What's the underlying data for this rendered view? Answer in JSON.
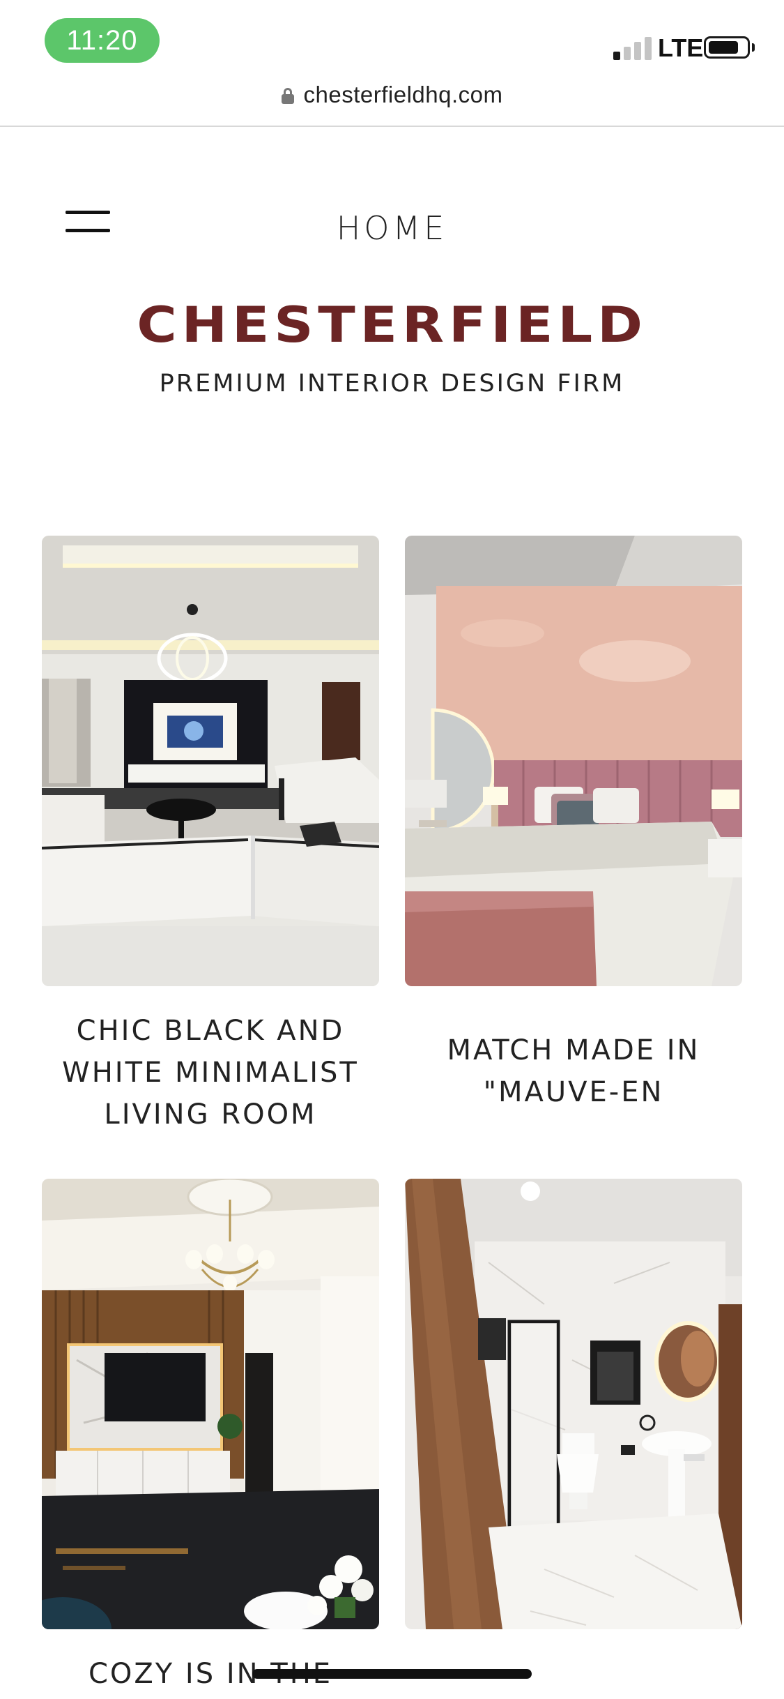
{
  "status_bar": {
    "time": "11:20",
    "network": "LTE",
    "battery_level": 0.8
  },
  "browser": {
    "url": "chesterfieldhq.com"
  },
  "header": {
    "nav_title": "HOME",
    "brand_name": "CHESTERFIELD",
    "tagline": "PREMIUM INTERIOR DESIGN FIRM"
  },
  "gallery": [
    {
      "caption": "CHIC BLACK AND WHITE MINIMALIST LIVING ROOM",
      "image_icon": "living-room-photo"
    },
    {
      "caption": "MATCH MADE IN \"MAUVE-EN",
      "image_icon": "bedroom-photo"
    },
    {
      "caption": "COZY IS IN THE",
      "image_icon": "tv-lounge-photo"
    },
    {
      "caption": "",
      "image_icon": "bathroom-photo"
    }
  ],
  "colors": {
    "brand": "#6b2424",
    "time_pill": "#5cc66a"
  }
}
